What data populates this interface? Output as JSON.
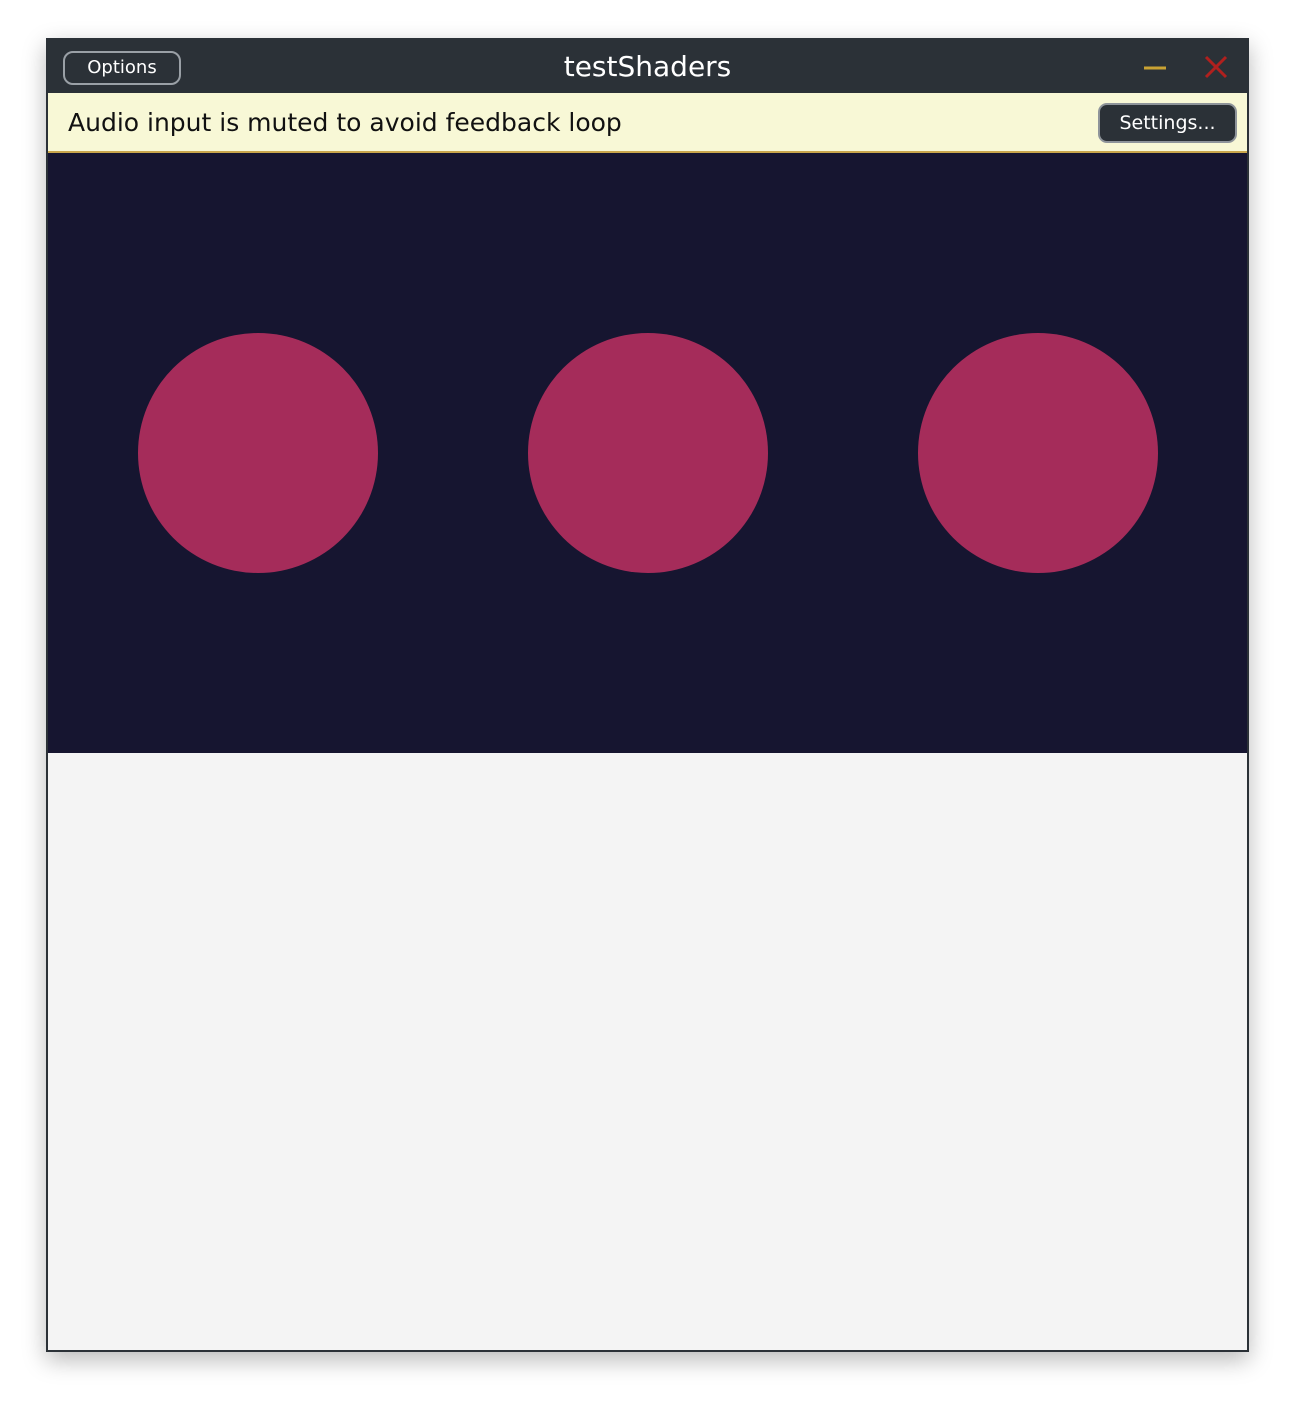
{
  "window": {
    "title": "testShaders",
    "options_label": "Options",
    "minimize_icon": "minimize-icon",
    "close_icon": "close-icon"
  },
  "banner": {
    "message": "Audio input is muted to avoid feedback loop",
    "settings_label": "Settings..."
  },
  "canvas": {
    "background_color": "#161530",
    "shape_color": "#a52c5a",
    "circle_count": 3
  },
  "colors": {
    "titlebar": "#2b3137",
    "banner": "#f8f8d6",
    "minimize_accent": "#c9a233",
    "close_accent": "#b0201e"
  }
}
